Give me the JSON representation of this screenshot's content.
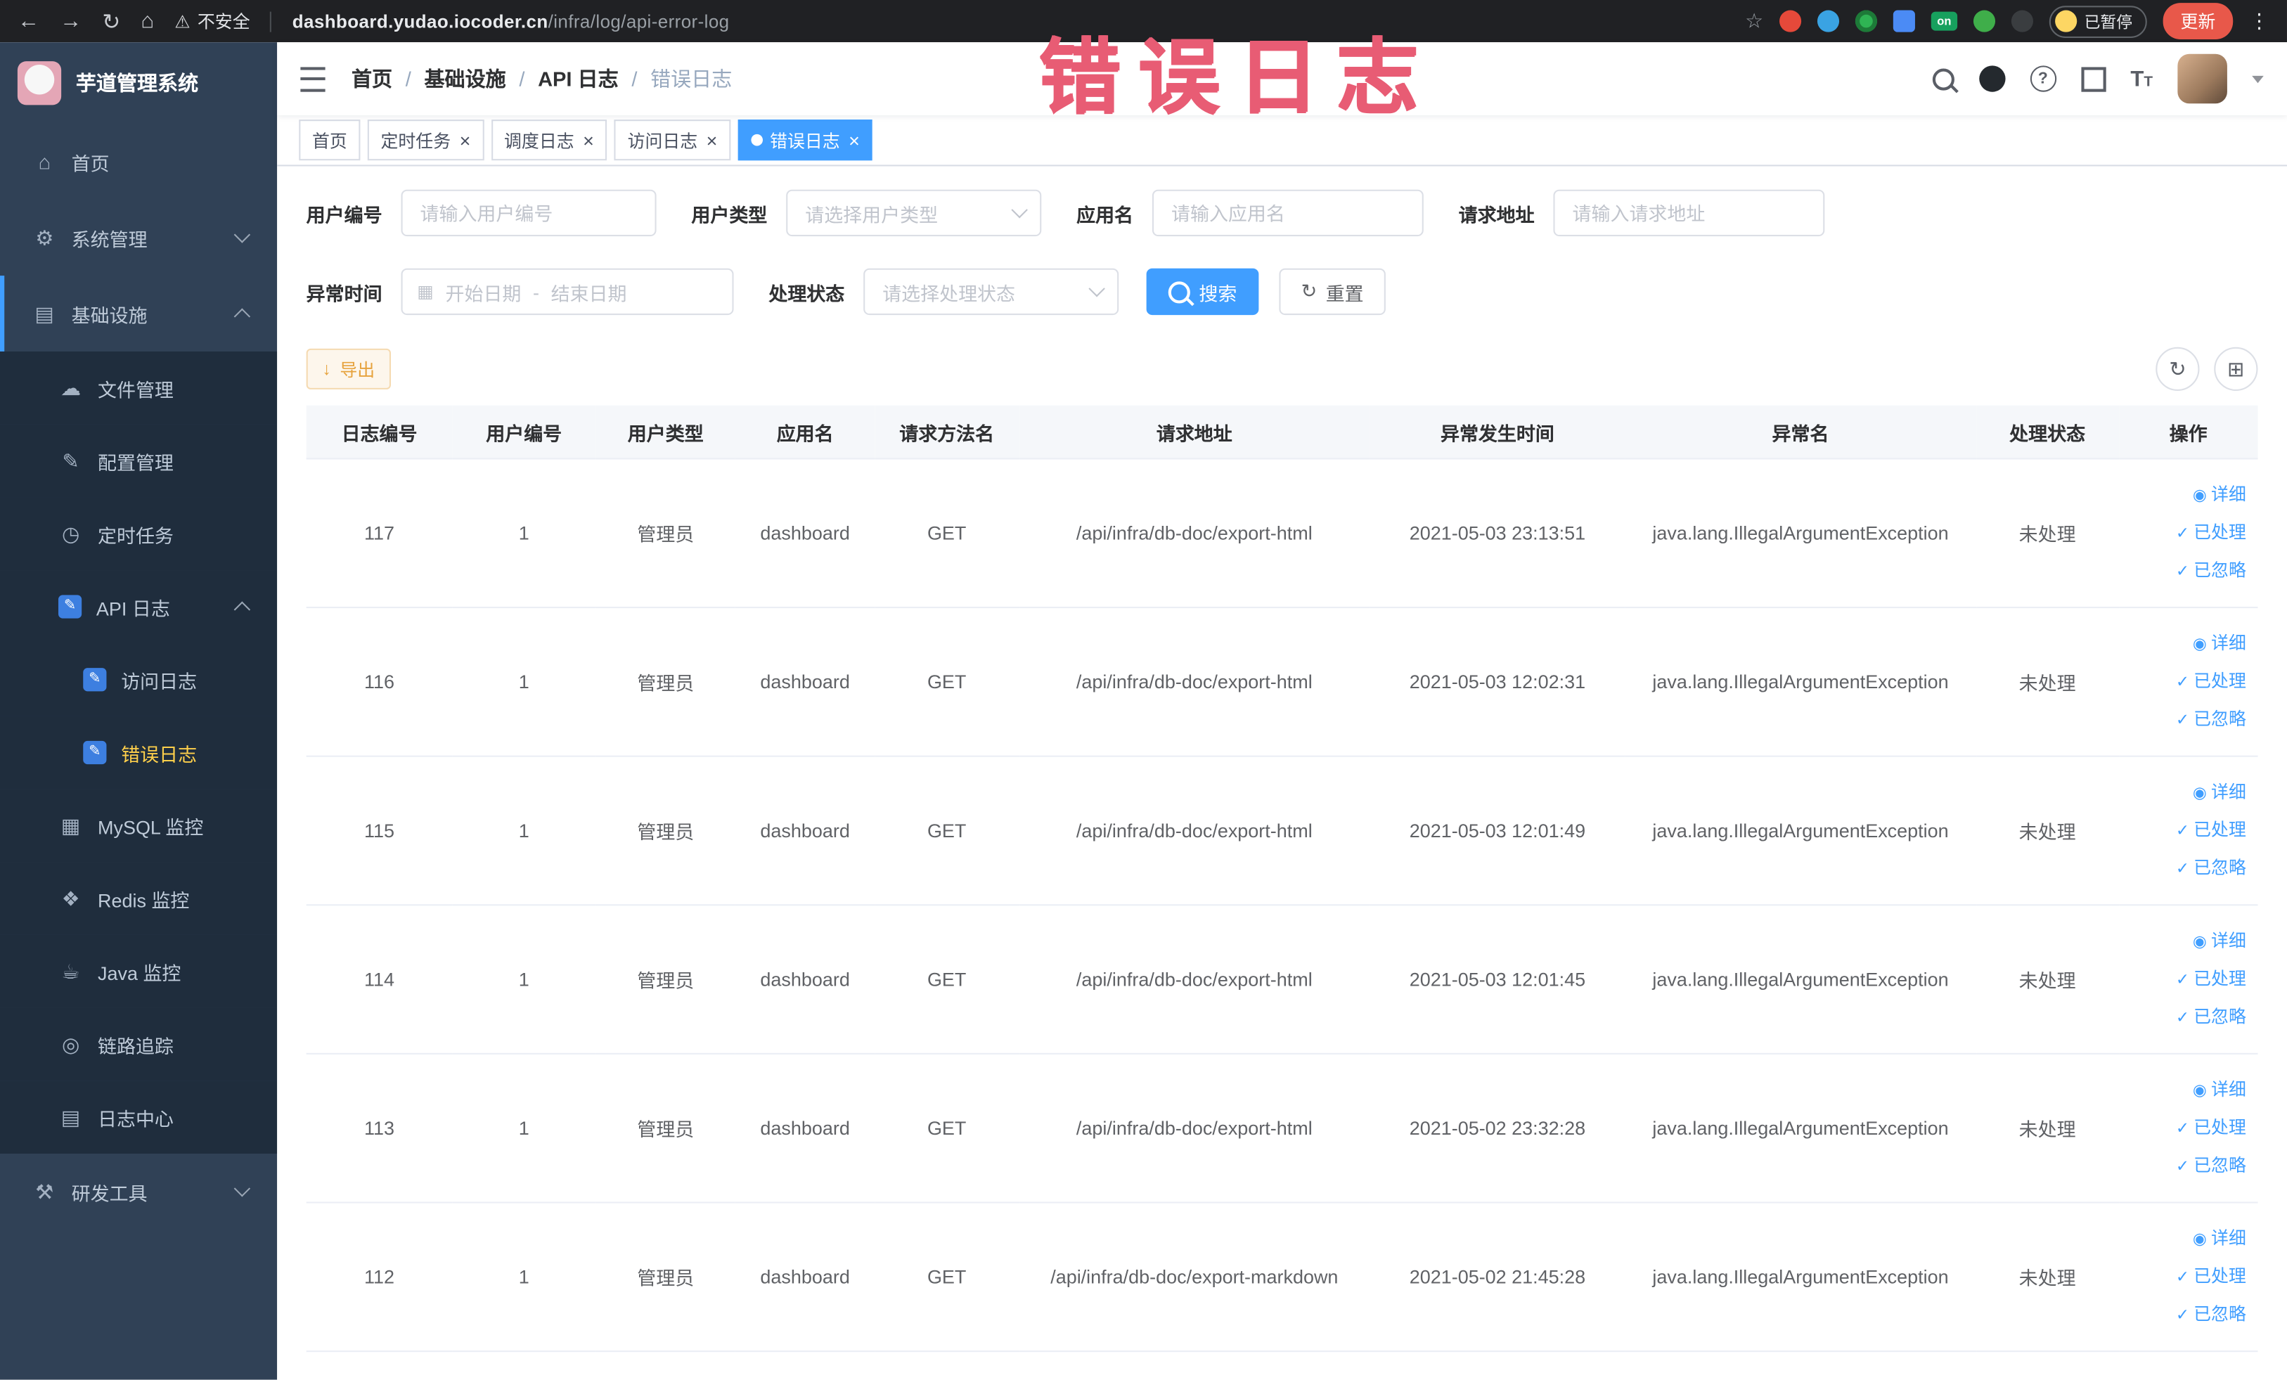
{
  "accent": {
    "primary": "#409eff",
    "warning": "#e6a23c",
    "sidebar_active": "#ffd04b"
  },
  "icons": {
    "back": "←",
    "forward": "→",
    "reload": "↻",
    "home": "⌂",
    "warning": "⚠",
    "star": "☆",
    "kebab": "⋮",
    "close": "×",
    "calendar": "▦",
    "download": "↓",
    "refresh": "↻",
    "grid": "⊞",
    "eye": "◉",
    "check": "✓"
  },
  "browser": {
    "security_warning": "不安全",
    "url_domain": "dashboard.yudao.iocoder.cn",
    "url_path": "/infra/log/api-error-log",
    "on_badge": "on",
    "paused_badge": "已暂停",
    "update_button": "更新"
  },
  "sidebar": {
    "logo_title": "芋道管理系统",
    "items": [
      {
        "key": "home",
        "label": "首页",
        "glyph": "⌂",
        "depth": 0
      },
      {
        "key": "system",
        "label": "系统管理",
        "glyph": "⚙",
        "depth": 0,
        "arrow": "down"
      },
      {
        "key": "infra",
        "label": "基础设施",
        "glyph": "▤",
        "depth": 0,
        "arrow": "up",
        "rootActive": true
      },
      {
        "key": "files",
        "label": "文件管理",
        "glyph": "☁",
        "depth": 1,
        "sub": true
      },
      {
        "key": "config",
        "label": "配置管理",
        "glyph": "✎",
        "depth": 1,
        "sub": true
      },
      {
        "key": "tasks",
        "label": "定时任务",
        "glyph": "◷",
        "depth": 1,
        "sub": true
      },
      {
        "key": "api-log",
        "label": "API 日志",
        "glyph": "✎",
        "depth": 1,
        "sub": true,
        "arrow": "up",
        "blueIcon": true
      },
      {
        "key": "access-log",
        "label": "访问日志",
        "glyph": "✎",
        "depth": 2,
        "sub": true,
        "blueIcon": true
      },
      {
        "key": "error-log",
        "label": "错误日志",
        "glyph": "✎",
        "depth": 2,
        "sub": true,
        "blueIcon": true,
        "active": true
      },
      {
        "key": "mysql",
        "label": "MySQL 监控",
        "glyph": "▦",
        "depth": 1,
        "sub": true
      },
      {
        "key": "redis",
        "label": "Redis 监控",
        "glyph": "❖",
        "depth": 1,
        "sub": true
      },
      {
        "key": "java",
        "label": "Java 监控",
        "glyph": "☕",
        "depth": 1,
        "sub": true
      },
      {
        "key": "trace",
        "label": "链路追踪",
        "glyph": "◎",
        "depth": 1,
        "sub": true
      },
      {
        "key": "log-center",
        "label": "日志中心",
        "glyph": "▤",
        "depth": 1,
        "sub": true
      },
      {
        "key": "devtools",
        "label": "研发工具",
        "glyph": "⚒",
        "depth": 0,
        "arrow": "down"
      }
    ]
  },
  "navbar": {
    "separator": "/",
    "breadcrumb": [
      {
        "label": "首页"
      },
      {
        "label": "基础设施"
      },
      {
        "label": "API 日志"
      },
      {
        "label": "错误日志",
        "current": true
      }
    ]
  },
  "annotation": "错误日志",
  "tabs": [
    {
      "label": "首页"
    },
    {
      "label": "定时任务",
      "closable": true
    },
    {
      "label": "调度日志",
      "closable": true
    },
    {
      "label": "访问日志",
      "closable": true
    },
    {
      "label": "错误日志",
      "closable": true,
      "active": true
    }
  ],
  "filters": {
    "user_id_label": "用户编号",
    "user_id_placeholder": "请输入用户编号",
    "user_type_label": "用户类型",
    "user_type_placeholder": "请选择用户类型",
    "app_name_label": "应用名",
    "app_name_placeholder": "请输入应用名",
    "request_url_label": "请求地址",
    "request_url_placeholder": "请输入请求地址",
    "exception_time_label": "异常时间",
    "start_date_placeholder": "开始日期",
    "range_separator": "-",
    "end_date_placeholder": "结束日期",
    "process_status_label": "处理状态",
    "process_status_placeholder": "请选择处理状态",
    "search_label": "搜索",
    "reset_label": "重置"
  },
  "toolbar": {
    "export_label": "导出"
  },
  "table": {
    "columns": [
      "日志编号",
      "用户编号",
      "用户类型",
      "应用名",
      "请求方法名",
      "请求地址",
      "异常发生时间",
      "异常名",
      "处理状态",
      "操作"
    ],
    "action_labels": [
      "详细",
      "已处理",
      "已忽略"
    ],
    "rows": [
      {
        "id": "117",
        "user_id": "1",
        "user_type": "管理员",
        "app": "dashboard",
        "method": "GET",
        "url": "/api/infra/db-doc/export-html",
        "time": "2021-05-03 23:13:51",
        "exception": "java.lang.IllegalArgumentException",
        "status": "未处理"
      },
      {
        "id": "116",
        "user_id": "1",
        "user_type": "管理员",
        "app": "dashboard",
        "method": "GET",
        "url": "/api/infra/db-doc/export-html",
        "time": "2021-05-03 12:02:31",
        "exception": "java.lang.IllegalArgumentException",
        "status": "未处理"
      },
      {
        "id": "115",
        "user_id": "1",
        "user_type": "管理员",
        "app": "dashboard",
        "method": "GET",
        "url": "/api/infra/db-doc/export-html",
        "time": "2021-05-03 12:01:49",
        "exception": "java.lang.IllegalArgumentException",
        "status": "未处理"
      },
      {
        "id": "114",
        "user_id": "1",
        "user_type": "管理员",
        "app": "dashboard",
        "method": "GET",
        "url": "/api/infra/db-doc/export-html",
        "time": "2021-05-03 12:01:45",
        "exception": "java.lang.IllegalArgumentException",
        "status": "未处理"
      },
      {
        "id": "113",
        "user_id": "1",
        "user_type": "管理员",
        "app": "dashboard",
        "method": "GET",
        "url": "/api/infra/db-doc/export-html",
        "time": "2021-05-02 23:32:28",
        "exception": "java.lang.IllegalArgumentException",
        "status": "未处理"
      },
      {
        "id": "112",
        "user_id": "1",
        "user_type": "管理员",
        "app": "dashboard",
        "method": "GET",
        "url": "/api/infra/db-doc/export-markdown",
        "time": "2021-05-02 21:45:28",
        "exception": "java.lang.IllegalArgumentException",
        "status": "未处理"
      }
    ]
  }
}
